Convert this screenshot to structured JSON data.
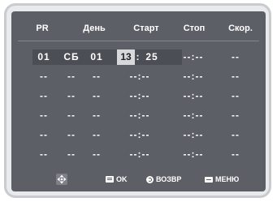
{
  "header": {
    "pr": "PR",
    "day": "День",
    "start": "Старт",
    "stop": "Стоп",
    "speed": "Скор."
  },
  "active_row": {
    "pr": "01",
    "day": "СБ",
    "date": "01",
    "hour": "13",
    "colon": ":",
    "minute": "25",
    "stop": "--:--",
    "speed": "--"
  },
  "empty_row": {
    "pr": "--",
    "day": "--",
    "date": "--",
    "start": "--:--",
    "stop": "--:--",
    "speed": "--"
  },
  "footer": {
    "ok_label": "OK",
    "return_label": "ВОЗВР",
    "menu_label": "МЕНЮ"
  },
  "icons": {
    "navigation": "four-way-arrows-icon",
    "ok": "ok-icon",
    "return": "return-icon",
    "menu": "menu-icon"
  },
  "colors": {
    "panel_bg": "#5c5f66",
    "text": "#ffffff",
    "hour_highlight": "#d7d8da",
    "frame": "#c9cbcf"
  }
}
